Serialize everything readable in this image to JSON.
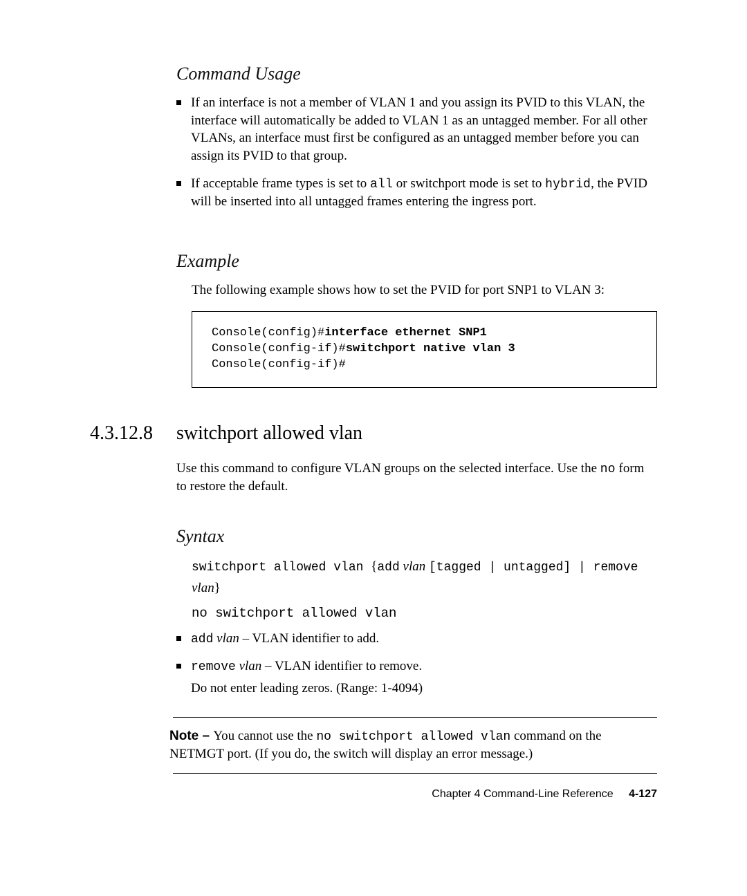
{
  "usage": {
    "heading": "Command Usage",
    "bullets": [
      {
        "plain1": "If an interface is not a member of VLAN 1 and you assign its PVID to this VLAN, the interface will automatically be added to VLAN 1 as an untagged member. For all other VLANs, an interface must first be configured as an untagged member before you can assign its PVID to that group."
      },
      {
        "pre": "If acceptable frame types is set to ",
        "mono1": "all",
        "mid": " or switchport mode is set to ",
        "mono2": "hybrid",
        "post": ", the PVID will be inserted into all untagged frames entering the ingress port."
      }
    ]
  },
  "example": {
    "heading": "Example",
    "intro": "The following example shows how to set the PVID for port SNP1 to VLAN 3:",
    "lines": {
      "l1_pre": "Console(config)#",
      "l1_bold": "interface ethernet SNP1",
      "l2_pre": "Console(config-if)#",
      "l2_bold": "switchport native vlan 3",
      "l3": "Console(config-if)#"
    }
  },
  "section": {
    "number": "4.3.12.8",
    "title": "switchport allowed vlan",
    "intro_pre": "Use this command to configure VLAN groups on the selected interface. Use the ",
    "intro_mono": "no",
    "intro_post": " form to restore the default."
  },
  "syntax": {
    "heading": "Syntax",
    "line1": {
      "pre_mono": "switchport allowed vlan ",
      "brace_open": "{",
      "add": "add",
      "space1": " ",
      "vlan1": "vlan",
      "space2": " ",
      "bracket": "[tagged | untagged] | ",
      "remove": "remove",
      "space3": " ",
      "vlan2": "vlan",
      "brace_close": "}"
    },
    "line2": "no switchport allowed vlan",
    "bulletA": {
      "mono": "add",
      "space": " ",
      "ital": "vlan",
      "rest": " – VLAN identifier to add."
    },
    "bulletB": {
      "mono": "remove",
      "space": " ",
      "ital": "vlan",
      "rest": " – VLAN identifier to remove.",
      "sub": "Do not enter leading zeros. (Range: 1-4094)"
    }
  },
  "note": {
    "label": "Note – ",
    "pre": "You cannot use the ",
    "mono": "no switchport allowed vlan",
    "post": " command on the NETMGT port. (If you do, the switch will display an error message.)"
  },
  "footer": {
    "chapter": "Chapter 4    Command-Line Reference",
    "page": "4-127"
  }
}
